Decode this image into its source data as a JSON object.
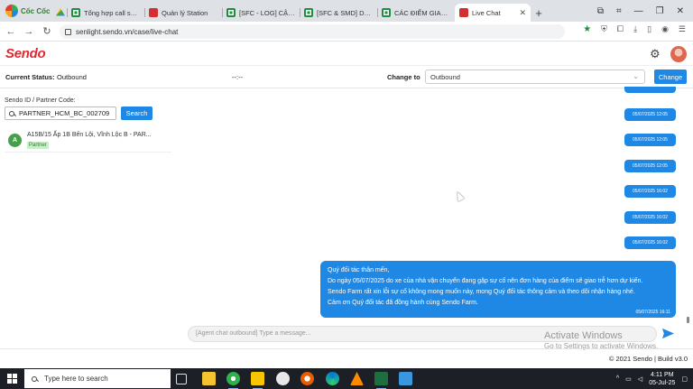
{
  "browser": {
    "brand": "Cốc Cốc",
    "tabs": [
      {
        "label": "Tổng hợp call script",
        "icon": "sheets-icon"
      },
      {
        "label": "Quản lý Station",
        "icon": "sendo-icon"
      },
      {
        "label": "[SFC - LOG] CẬP NHẬ",
        "icon": "sheets-icon"
      },
      {
        "label": "[SFC & SMD] Danh",
        "icon": "sheets-icon"
      },
      {
        "label": "CÁC ĐIỂM GIAO TRẢ",
        "icon": "sheets-icon"
      },
      {
        "label": "Live Chat",
        "icon": "sendo-icon"
      }
    ],
    "url": "senlight.sendo.vn/case/live-chat"
  },
  "app": {
    "logo": "Sendo",
    "current_status_label": "Current Status:",
    "current_status_value": "Outbound",
    "status_separator": "--:--",
    "change_to_label": "Change to",
    "change_to_value": "Outbound",
    "change_button": "Change"
  },
  "left": {
    "partner_label": "Sendo ID / Partner Code:",
    "partner_value": "PARTNER_HCM_BC_002709",
    "search_button": "Search",
    "conversations": [
      {
        "avatar": "A",
        "title": "A15B/15 Ấp 1B Bến Lội, Vĩnh Lộc B - PAR...",
        "tag": "Partner"
      }
    ]
  },
  "chat": {
    "small_messages": [
      "05/07/2025 12:05",
      "05/07/2025 12:05",
      "05/07/2025 12:05",
      "05/07/2025 16:02",
      "05/07/2025 16:02",
      "05/07/2025 16:02"
    ],
    "main_message": {
      "lines": [
        "Quý đối tác thân mến,",
        "Do ngày 05/07/2025 do xe của nhà vận chuyển đang gặp sự cố nên đơn hàng của điểm sẽ giao trễ hơn dự kiến.",
        "Sendo Farm rất xin lỗi sự cố không mong muốn này, mong  Quý đối tác thông cảm và theo dõi nhận hàng nhé.",
        "Cảm ơn Quý đối tác đã đồng hành cùng Sendo Farm."
      ],
      "time": "05/07/2025 16:11"
    },
    "composer_placeholder": "[Agent chat outbound] Type a message..."
  },
  "watermark": {
    "title": "Activate Windows",
    "subtitle": "Go to Settings to activate Windows."
  },
  "footer": "© 2021 Sendo | Build v3.0",
  "taskbar": {
    "search_placeholder": "Type here to search",
    "time": "4:11 PM",
    "date": "05-Jul-25"
  }
}
